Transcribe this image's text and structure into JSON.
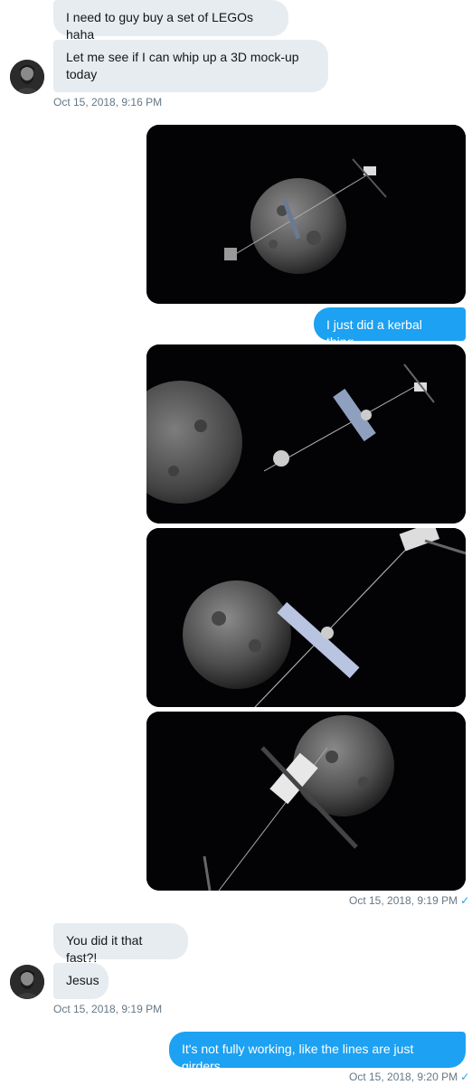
{
  "conversation": {
    "messages": [
      {
        "id": "m1",
        "direction": "received",
        "text": "I need to guy buy a set of LEGOs haha"
      },
      {
        "id": "m2",
        "direction": "received",
        "text": "Let me see if I can whip up a 3D mock-up today"
      },
      {
        "id": "t1",
        "timestamp": "Oct 15, 2018, 9:16 PM"
      },
      {
        "id": "m3",
        "direction": "sent",
        "text": "I just did a kerbal thing"
      },
      {
        "id": "t2",
        "timestamp": "Oct 15, 2018, 9:19 PM",
        "read": "✓"
      },
      {
        "id": "m4",
        "direction": "received",
        "text": "You did it that fast?!"
      },
      {
        "id": "m5",
        "direction": "received",
        "text": "Jesus"
      },
      {
        "id": "t3",
        "timestamp": "Oct 15, 2018, 9:19 PM"
      },
      {
        "id": "m6",
        "direction": "sent",
        "text": "It's not fully working, like the lines are just girders"
      },
      {
        "id": "t4",
        "timestamp": "Oct 15, 2018, 9:20 PM",
        "read": "✓"
      }
    ]
  },
  "icons": {
    "avatar": "avatar",
    "read_receipt": "check-icon"
  },
  "colors": {
    "sent_bubble": "#1da1f2",
    "received_bubble": "#e6ecf0",
    "timestamp": "#657786"
  }
}
